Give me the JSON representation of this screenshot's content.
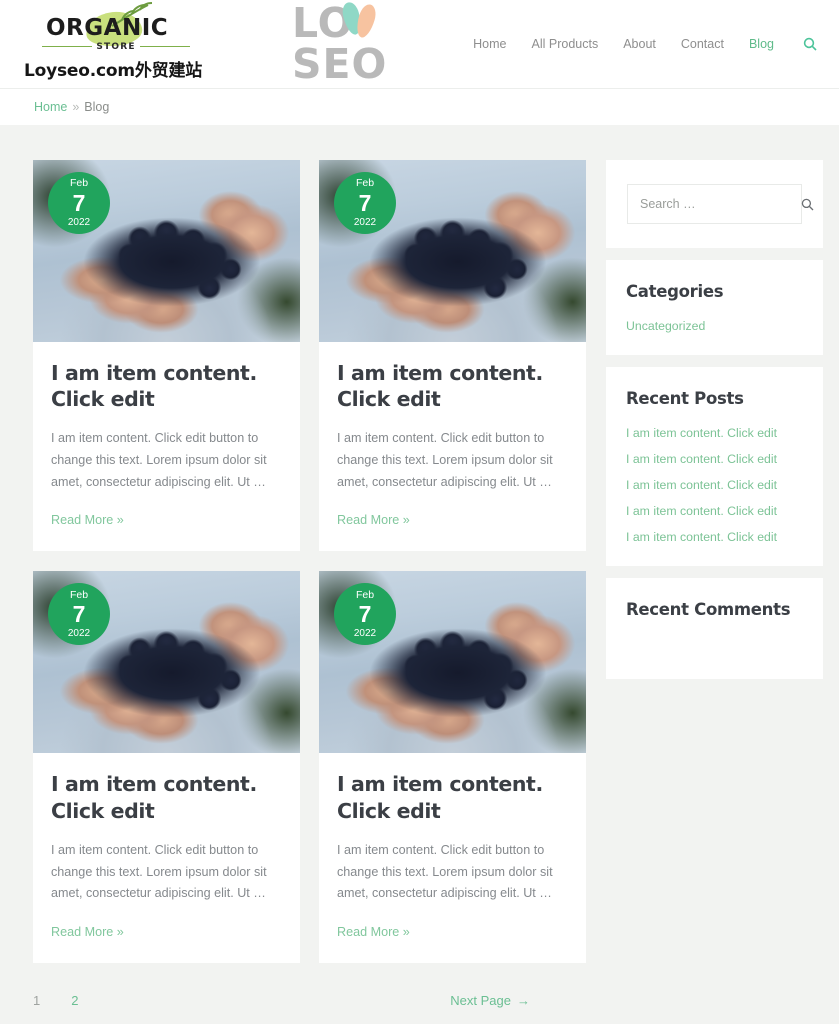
{
  "header": {
    "brand_logo_word": "ORGANIC",
    "brand_logo_store": "STORE",
    "brand_subtitle": "Loyseo.com外贸建站",
    "loyseo_left": "LO",
    "loyseo_right": "SEO",
    "nav": [
      {
        "label": "Home",
        "active": false
      },
      {
        "label": "All Products",
        "active": false
      },
      {
        "label": "About",
        "active": false
      },
      {
        "label": "Contact",
        "active": false
      },
      {
        "label": "Blog",
        "active": true
      }
    ],
    "search_icon": "search-icon"
  },
  "breadcrumb": {
    "home": "Home",
    "separator": "»",
    "current": "Blog"
  },
  "posts": [
    {
      "date": {
        "month": "Feb",
        "day": "7",
        "year": "2022"
      },
      "title": "I am item content. Click edit",
      "excerpt": "I am item content. Click edit button to change this text. Lorem ipsum dolor sit amet, consectetur adipiscing elit. Ut …",
      "read_more": "Read More »"
    },
    {
      "date": {
        "month": "Feb",
        "day": "7",
        "year": "2022"
      },
      "title": "I am item content. Click edit",
      "excerpt": "I am item content. Click edit button to change this text. Lorem ipsum dolor sit amet, consectetur adipiscing elit. Ut …",
      "read_more": "Read More »"
    },
    {
      "date": {
        "month": "Feb",
        "day": "7",
        "year": "2022"
      },
      "title": "I am item content. Click edit",
      "excerpt": "I am item content. Click edit button to change this text. Lorem ipsum dolor sit amet, consectetur adipiscing elit. Ut …",
      "read_more": "Read More »"
    },
    {
      "date": {
        "month": "Feb",
        "day": "7",
        "year": "2022"
      },
      "title": "I am item content. Click edit",
      "excerpt": "I am item content. Click edit button to change this text. Lorem ipsum dolor sit amet, consectetur adipiscing elit. Ut …",
      "read_more": "Read More »"
    }
  ],
  "sidebar": {
    "search": {
      "placeholder": "Search …",
      "value": "",
      "icon": "search-icon"
    },
    "categories": {
      "title": "Categories",
      "items": [
        "Uncategorized"
      ]
    },
    "recent_posts": {
      "title": "Recent Posts",
      "items": [
        "I am item content. Click edit",
        "I am item content. Click edit",
        "I am item content. Click edit",
        "I am item content. Click edit",
        "I am item content. Click edit"
      ]
    },
    "recent_comments": {
      "title": "Recent Comments",
      "items": []
    }
  },
  "pagination": {
    "pages": [
      {
        "label": "1",
        "current": true
      },
      {
        "label": "2",
        "current": false
      }
    ],
    "next_label": "Next Page",
    "next_arrow": "→"
  },
  "colors": {
    "accent_green": "#6bbf93",
    "badge_green": "#21a45d",
    "link_green": "#7cc396",
    "page_bg": "#f2f3f1",
    "heading": "#3b3f45",
    "body_text": "#85898d"
  }
}
